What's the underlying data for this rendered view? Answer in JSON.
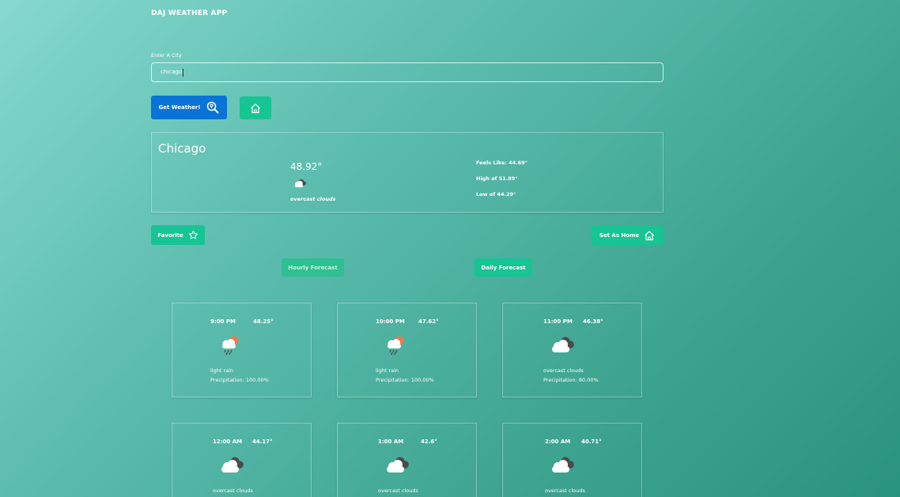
{
  "header": {
    "title": "DAJ WEATHER APP"
  },
  "search": {
    "label": "Enter A City",
    "value": "chicago",
    "get_weather_label": "Get Weather!"
  },
  "current": {
    "city": "Chicago",
    "temp": "48.92°",
    "description": "overcast clouds",
    "feels_like": "Feels Like: 44.69°",
    "high": "High of 51.89°",
    "low": "Low of 44.29°",
    "icon": "overcast-clouds-icon"
  },
  "actions": {
    "favorite_label": "Favorite",
    "set_home_label": "Set As Home"
  },
  "tabs": {
    "hourly": "Hourly Forecast",
    "daily": "Daily Forecast"
  },
  "hourly": [
    {
      "time": "9:00 PM",
      "temp": "48.25°",
      "desc": "light rain",
      "precip": "Precipitation: 100.00%",
      "icon": "light-rain-icon"
    },
    {
      "time": "10:00 PM",
      "temp": "47.62°",
      "desc": "light rain",
      "precip": "Precipitation: 100.00%",
      "icon": "light-rain-icon"
    },
    {
      "time": "11:00 PM",
      "temp": "46.38°",
      "desc": "overcast clouds",
      "precip": "Precipitation: 80.00%",
      "icon": "overcast-clouds-icon"
    },
    {
      "time": "12:00 AM",
      "temp": "44.17°",
      "desc": "overcast clouds",
      "precip": "",
      "icon": "overcast-clouds-icon"
    },
    {
      "time": "1:00 AM",
      "temp": "42.6°",
      "desc": "overcast clouds",
      "precip": "",
      "icon": "overcast-clouds-icon"
    },
    {
      "time": "2:00 AM",
      "temp": "40.71°",
      "desc": "overcast clouds",
      "precip": "",
      "icon": "overcast-clouds-icon"
    }
  ],
  "colors": {
    "primary_button": "#0a73d6",
    "accent_green": "#17c493",
    "sun": "#f0784a",
    "dark_cloud": "#4a4a4a"
  }
}
